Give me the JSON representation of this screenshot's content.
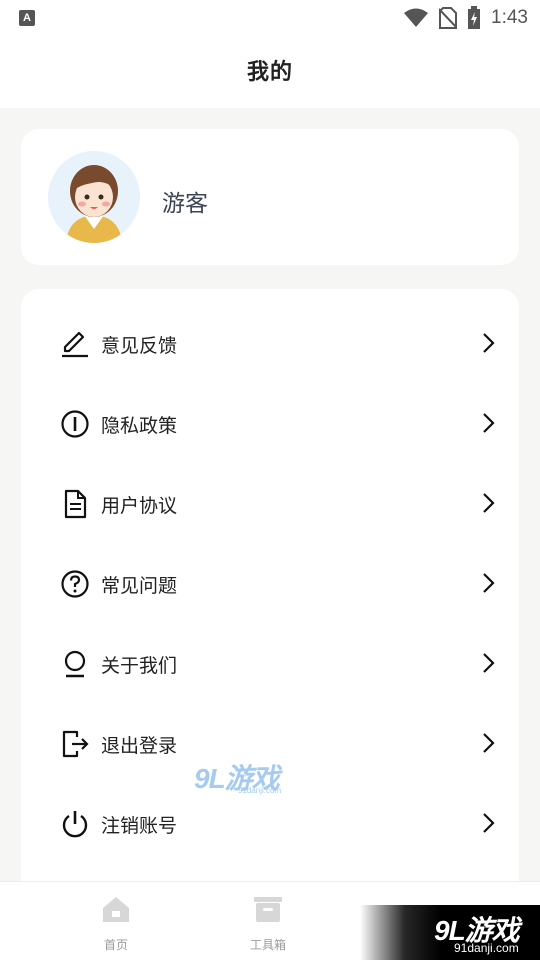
{
  "status_bar": {
    "app_indicator": "A",
    "time": "1:43"
  },
  "header": {
    "title": "我的"
  },
  "profile": {
    "username": "游客"
  },
  "menu": {
    "items": [
      {
        "label": "意见反馈",
        "icon": "edit-pen-icon"
      },
      {
        "label": "隐私政策",
        "icon": "info-circle-icon"
      },
      {
        "label": "用户协议",
        "icon": "document-icon"
      },
      {
        "label": "常见问题",
        "icon": "question-circle-icon"
      },
      {
        "label": "关于我们",
        "icon": "person-outline-icon"
      },
      {
        "label": "退出登录",
        "icon": "logout-icon"
      },
      {
        "label": "注销账号",
        "icon": "power-icon"
      }
    ]
  },
  "bottom_nav": {
    "items": [
      {
        "label": "首页",
        "icon": "home-icon"
      },
      {
        "label": "工具箱",
        "icon": "toolbox-icon"
      }
    ]
  },
  "watermark": {
    "center_main": "9L游戏",
    "center_sub": "91danji.com",
    "corner_main": "9L游戏",
    "corner_sub": "91danji.com"
  },
  "colors": {
    "background": "#f6f6f4",
    "card": "#ffffff",
    "text": "#222222",
    "nav_inactive": "#9a9a9a"
  }
}
